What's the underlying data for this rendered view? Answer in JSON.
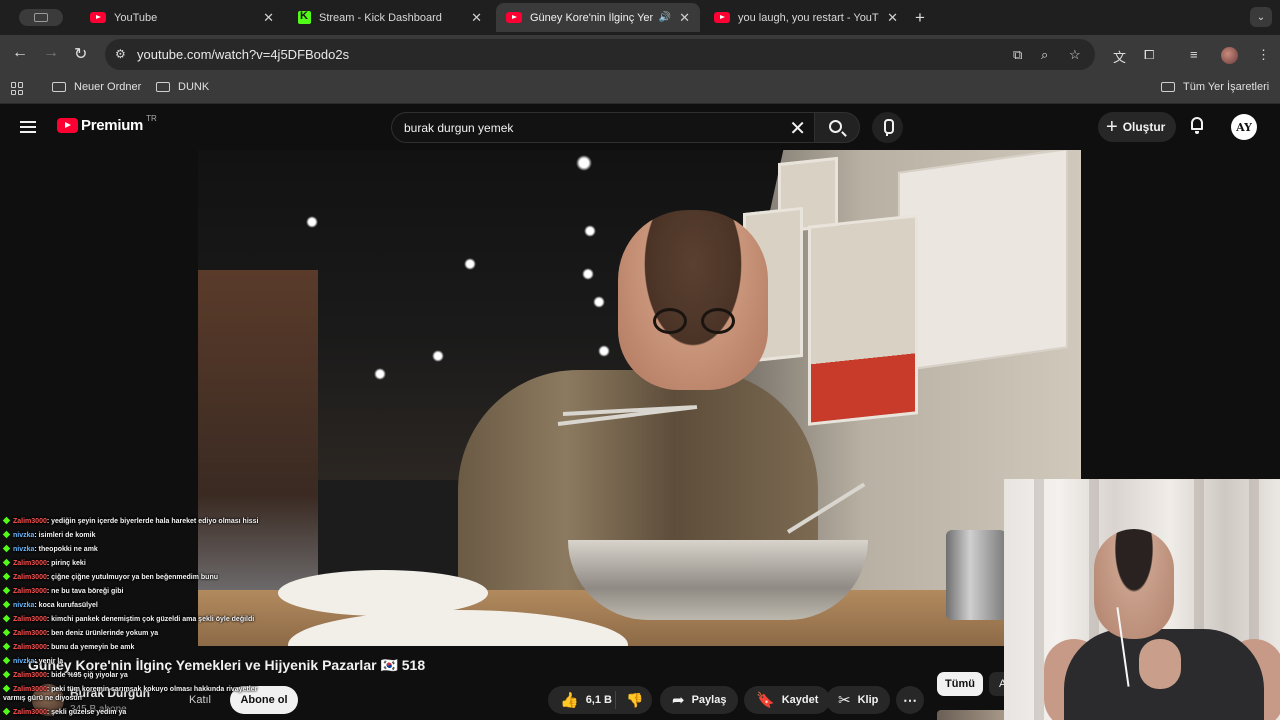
{
  "browser": {
    "tabs": [
      {
        "title": "YouTube",
        "favicon": "youtube-icon",
        "active": false
      },
      {
        "title": "Stream - Kick Dashboard",
        "favicon": "kick-icon",
        "active": false
      },
      {
        "title": "Güney Kore'nin İlginç Yemekleri",
        "favicon": "youtube-icon",
        "active": true,
        "audio": true
      },
      {
        "title": "you laugh, you restart - YouTube",
        "favicon": "youtube-icon",
        "active": false
      }
    ],
    "url": "youtube.com/watch?v=4j5DFBodo2s",
    "bookmarks": [
      "Neuer Ordner",
      "DUNK"
    ],
    "all_bookmarks_label": "Tüm Yer İşaretleri"
  },
  "youtube": {
    "logo_word": "Premium",
    "country_code": "TR",
    "search_query": "burak durgun yemek",
    "create_label": "Oluştur",
    "account_initials": "AY",
    "video_title": "Güney Kore'nin İlginç Yemekleri ve Hijyenik Pazarlar 🇰🇷 518",
    "channel_name": "Burak Durgun",
    "subscribers": "345 B abone",
    "join_label": "Katıl",
    "subscribe_label": "Abone ol",
    "like_count": "6,1 B",
    "share_label": "Paylaş",
    "save_label": "Kaydet",
    "clip_label": "Klip",
    "chips": [
      "Tümü",
      "A"
    ]
  },
  "chat": [
    {
      "user": "Zalim3000",
      "color": "#ff4f4f",
      "text": ": yediğin şeyin içerde biyerlerde hala hareket ediyo olması hissi"
    },
    {
      "user": "nivzka",
      "color": "#6fb8ff",
      "text": ": isimleri de komik"
    },
    {
      "user": "nivzka",
      "color": "#6fb8ff",
      "text": ": theopokki ne amk"
    },
    {
      "user": "Zalim3000",
      "color": "#ff4f4f",
      "text": ": pirinç keki"
    },
    {
      "user": "Zalim3000",
      "color": "#ff4f4f",
      "text": ": çiğne çiğne yutulmuyor ya ben beğenmedim bunu"
    },
    {
      "user": "Zalim3000",
      "color": "#ff4f4f",
      "text": ": ne bu tava böreği gibi"
    },
    {
      "user": "nivzka",
      "color": "#6fb8ff",
      "text": ": koca kurufasülyel"
    },
    {
      "user": "Zalim3000",
      "color": "#ff4f4f",
      "text": ": kimchi pankek denemiştim çok güzeldi ama şekli öyle değildi"
    },
    {
      "user": "Zalim3000",
      "color": "#ff4f4f",
      "text": ": ben deniz ürünlerinde yokum ya"
    },
    {
      "user": "Zalim3000",
      "color": "#ff4f4f",
      "text": ": bunu da yemeyin be amk"
    },
    {
      "user": "nivzka",
      "color": "#6fb8ff",
      "text": ": yenir la"
    },
    {
      "user": "Zalim3000",
      "color": "#ff4f4f",
      "text": ": bide %95 çiğ yiyolar ya"
    },
    {
      "user": "Zalim3000",
      "color": "#ff4f4f",
      "text": ": peki tüm koremin sarımsak kokuyo olması hakkında rivayetler varmış gürü ne diyosun"
    },
    {
      "user": "Zalim3000",
      "color": "#ff4f4f",
      "text": ": şekli güzelse yedim ya"
    }
  ]
}
